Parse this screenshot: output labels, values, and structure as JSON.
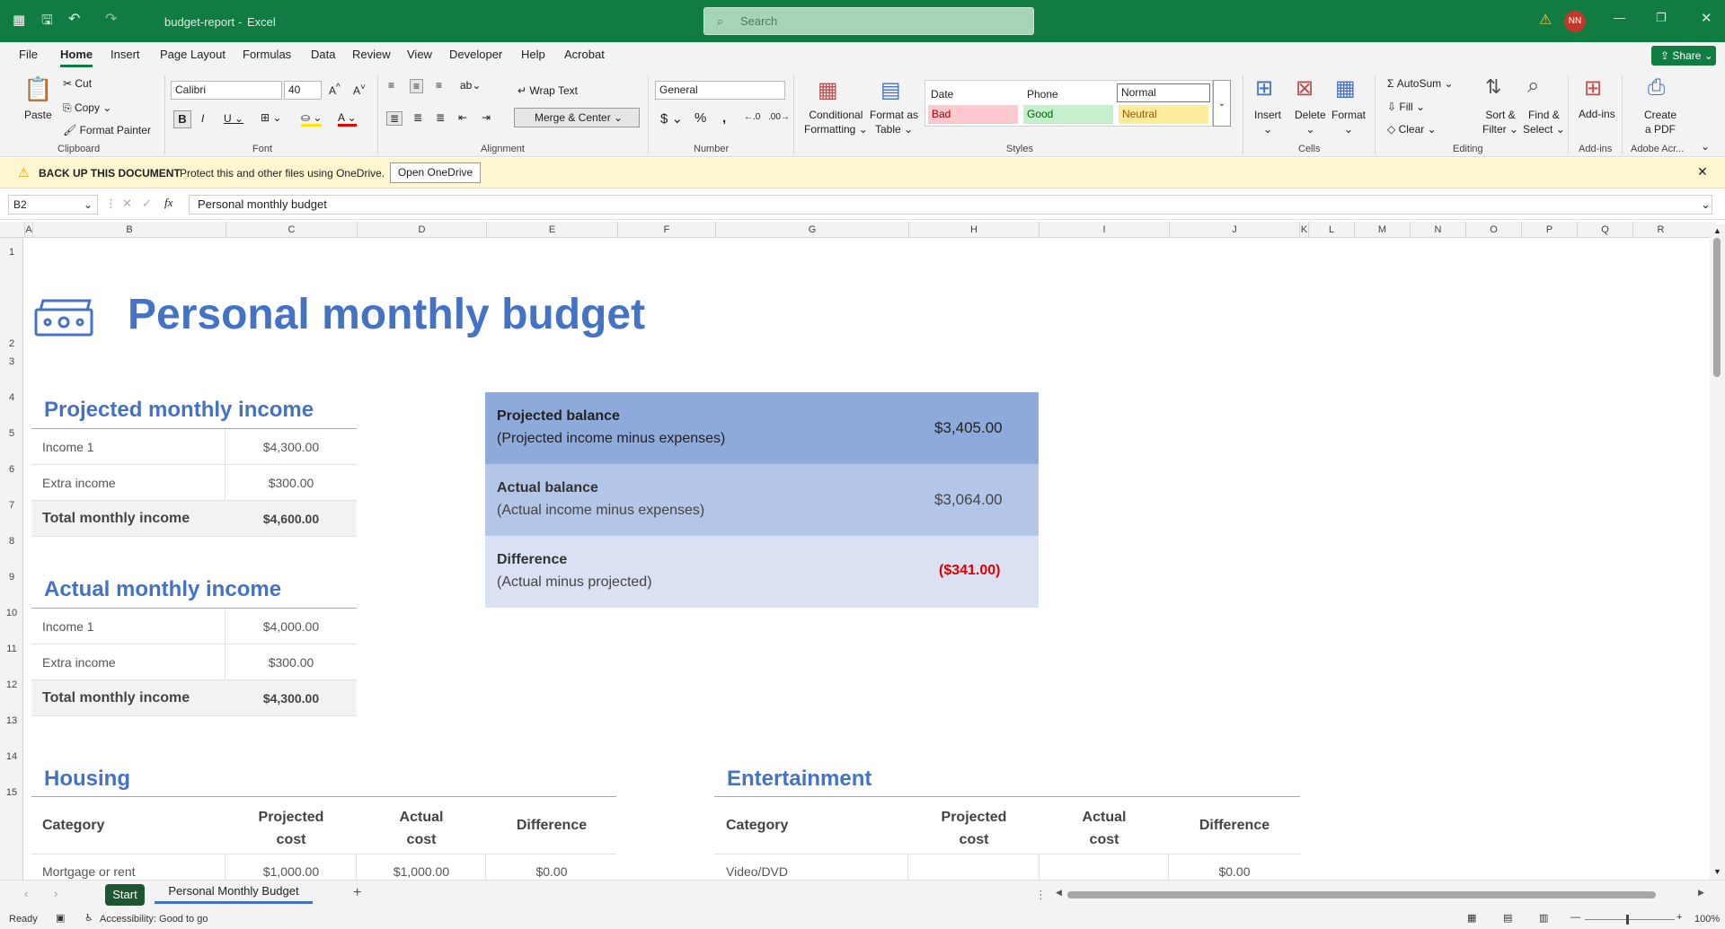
{
  "title_bar": {
    "doc_name": "budget-report",
    "app_name": "Excel",
    "search_placeholder": "Search",
    "user_initials": "NN"
  },
  "menu": [
    "File",
    "Home",
    "Insert",
    "Page Layout",
    "Formulas",
    "Data",
    "Review",
    "View",
    "Developer",
    "Help",
    "Acrobat"
  ],
  "share_label": "Share",
  "ribbon": {
    "clipboard": {
      "paste": "Paste",
      "cut": "Cut",
      "copy": "Copy",
      "format_painter": "Format Painter",
      "label": "Clipboard"
    },
    "font": {
      "name": "Calibri",
      "size": "40",
      "label": "Font"
    },
    "alignment": {
      "wrap": "Wrap Text",
      "merge": "Merge & Center",
      "label": "Alignment"
    },
    "number": {
      "format": "General",
      "label": "Number"
    },
    "styles": {
      "cond1": "Conditional",
      "cond2": "Formatting",
      "fmt1": "Format as",
      "fmt2": "Table",
      "date": "Date",
      "phone": "Phone",
      "normal": "Normal",
      "bad": "Bad",
      "good": "Good",
      "neutral": "Neutral",
      "label": "Styles"
    },
    "cells": {
      "insert": "Insert",
      "delete": "Delete",
      "format": "Format",
      "label": "Cells"
    },
    "editing": {
      "autosum": "AutoSum",
      "fill": "Fill",
      "clear": "Clear",
      "sort1": "Sort &",
      "sort2": "Filter",
      "find1": "Find &",
      "find2": "Select",
      "label": "Editing"
    },
    "addins": {
      "addins": "Add-ins",
      "label": "Add-ins"
    },
    "acrobat": {
      "create1": "Create",
      "create2": "a PDF",
      "label": "Adobe Acr..."
    }
  },
  "notification": {
    "title": "BACK UP THIS DOCUMENT",
    "message": "Protect this and other files using OneDrive.",
    "button": "Open OneDrive"
  },
  "formula_bar": {
    "cell_ref": "B2",
    "content": "Personal monthly budget"
  },
  "columns": [
    "A",
    "B",
    "C",
    "D",
    "E",
    "F",
    "G",
    "H",
    "I",
    "J",
    "K",
    "L",
    "M",
    "N",
    "O",
    "P",
    "Q",
    "R"
  ],
  "rows": [
    "1",
    "2",
    "3",
    "4",
    "5",
    "6",
    "7",
    "8",
    "9",
    "10",
    "11",
    "12",
    "13",
    "14",
    "15"
  ],
  "sheet": {
    "title": "Personal monthly budget",
    "projected_income": {
      "heading": "Projected monthly income",
      "rows": [
        [
          "Income 1",
          "$4,300.00"
        ],
        [
          "Extra income",
          "$300.00"
        ]
      ],
      "total": [
        "Total monthly income",
        "$4,600.00"
      ]
    },
    "actual_income": {
      "heading": "Actual monthly income",
      "rows": [
        [
          "Income 1",
          "$4,000.00"
        ],
        [
          "Extra income",
          "$300.00"
        ]
      ],
      "total": [
        "Total monthly income",
        "$4,300.00"
      ]
    },
    "balances": [
      {
        "label": "Projected balance",
        "sub": "(Projected income minus expenses)",
        "value": "$3,405.00",
        "color": "#8eaadb"
      },
      {
        "label": "Actual balance",
        "sub": "(Actual income minus expenses)",
        "value": "$3,064.00",
        "color": "#b4c6e7"
      },
      {
        "label": "Difference",
        "sub": "(Actual minus projected)",
        "value": "($341.00)",
        "color": "#d9e1f2",
        "value_color": "#e00000"
      }
    ],
    "housing": {
      "heading": "Housing",
      "cols": [
        "Category",
        "Projected\ncost",
        "Actual\ncost",
        "Difference"
      ],
      "row1": [
        "Mortgage or rent",
        "$1,000.00",
        "$1,000.00",
        "$0.00"
      ]
    },
    "entertainment": {
      "heading": "Entertainment",
      "cols": [
        "Category",
        "Projected\ncost",
        "Actual\ncost",
        "Difference"
      ],
      "row1": [
        "Video/DVD",
        "",
        "",
        "$0.00"
      ]
    }
  },
  "tabs": {
    "start": "Start",
    "sheet": "Personal Monthly Budget"
  },
  "status": {
    "ready": "Ready",
    "accessibility": "Accessibility: Good to go",
    "zoom": "100%"
  }
}
